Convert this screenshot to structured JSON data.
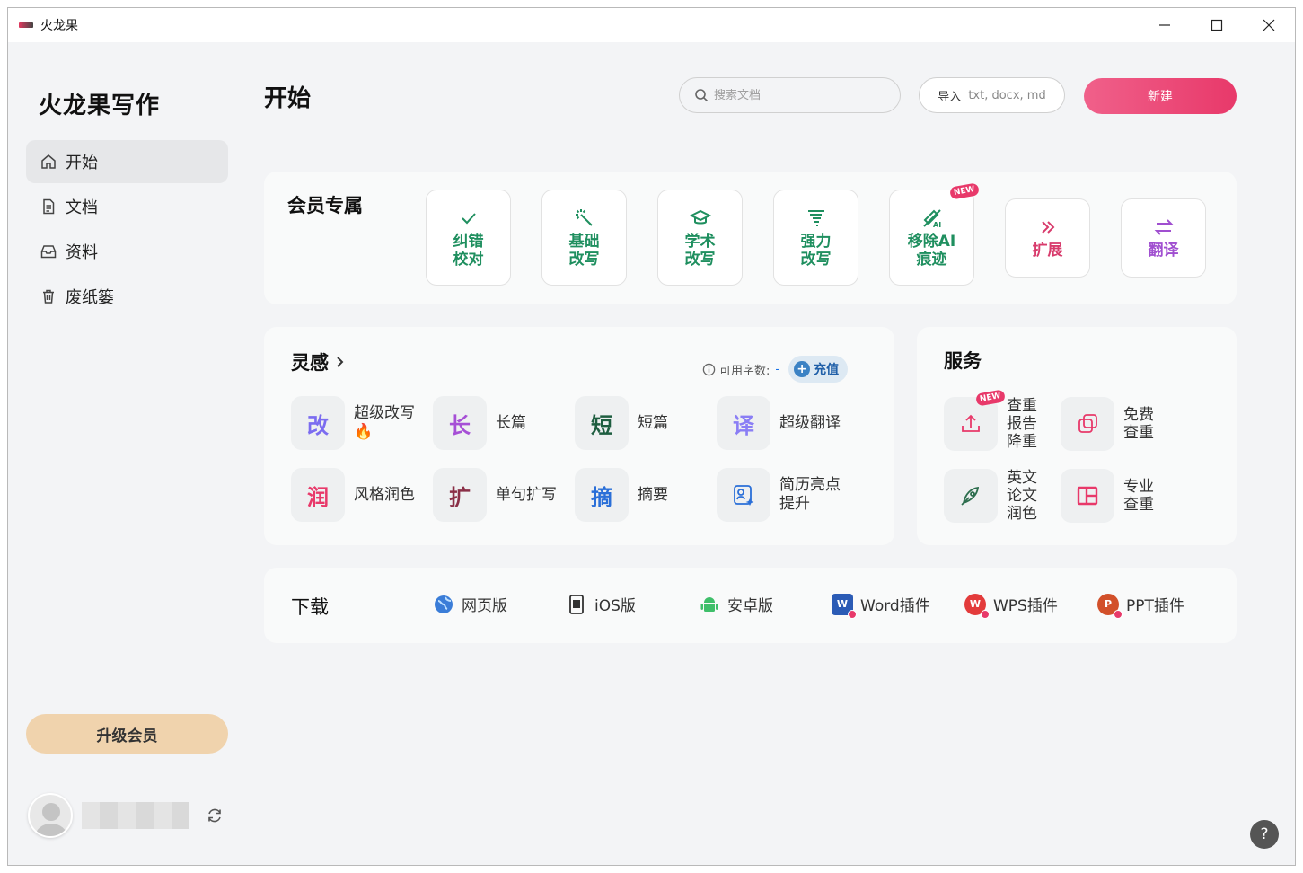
{
  "window": {
    "title": "火龙果"
  },
  "sidebar": {
    "logo_main": "火龙果写作",
    "items": [
      {
        "label": "开始",
        "icon": "home-icon"
      },
      {
        "label": "文档",
        "icon": "document-icon"
      },
      {
        "label": "资料",
        "icon": "inbox-icon"
      },
      {
        "label": "废纸篓",
        "icon": "trash-icon"
      }
    ],
    "upgrade_label": "升级会员"
  },
  "header": {
    "page_title": "开始",
    "search_placeholder": "搜索文档",
    "import_label": "导入",
    "import_formats": "txt, docx, md",
    "new_label": "新建"
  },
  "vip": {
    "title": "会员专属",
    "tiles": [
      {
        "label": "纠错校对",
        "icon": "check-icon",
        "color": "#1f8f5f"
      },
      {
        "label": "基础改写",
        "icon": "magic-wand-icon",
        "color": "#1f8f5f"
      },
      {
        "label": "学术改写",
        "icon": "graduation-cap-icon",
        "color": "#1f8f5f"
      },
      {
        "label": "强力改写",
        "icon": "tornado-icon",
        "color": "#1f8f5f"
      },
      {
        "label": "移除AI痕迹",
        "icon": "remove-ai-icon",
        "color": "#1f8f5f",
        "badge": "NEW"
      },
      {
        "label": "扩展",
        "icon": "double-chevron-icon",
        "color": "#d83b6c"
      },
      {
        "label": "翻译",
        "icon": "swap-arrows-icon",
        "color": "#a04fd0"
      }
    ]
  },
  "inspiration": {
    "title": "灵感",
    "quota_label": "可用字数:",
    "quota_value": "-",
    "recharge_label": "充值",
    "items": [
      {
        "chip": "改",
        "label": "超级改写🔥",
        "color": "#7b6cf0"
      },
      {
        "chip": "长",
        "label": "长篇",
        "color": "#a64fd6"
      },
      {
        "chip": "短",
        "label": "短篇",
        "color": "#1e5e40"
      },
      {
        "chip": "译",
        "label": "超级翻译",
        "color": "#8a7ef5"
      },
      {
        "chip": "润",
        "label": "风格润色",
        "color": "#e8396a"
      },
      {
        "chip": "扩",
        "label": "单句扩写",
        "color": "#8a2f47"
      },
      {
        "chip": "摘",
        "label": "摘要",
        "color": "#2a6fd8"
      },
      {
        "chip": "",
        "label": "简历亮点提升",
        "color": "#2a6fd8",
        "icon": "resume-sparkle-icon"
      }
    ]
  },
  "services": {
    "title": "服务",
    "items": [
      {
        "label": "查重报告降重",
        "icon": "upload-icon",
        "badge": "NEW"
      },
      {
        "label": "免费查重",
        "icon": "copy-squares-icon"
      },
      {
        "label": "英文论文润色",
        "icon": "quill-icon"
      },
      {
        "label": "专业查重",
        "icon": "layout-panel-icon"
      }
    ]
  },
  "download": {
    "title": "下载",
    "items": [
      {
        "label": "网页版",
        "icon": "globe-icon"
      },
      {
        "label": "iOS版",
        "icon": "phone-icon"
      },
      {
        "label": "安卓版",
        "icon": "android-icon"
      },
      {
        "label": "Word插件",
        "icon": "word-icon"
      },
      {
        "label": "WPS插件",
        "icon": "wps-icon"
      },
      {
        "label": "PPT插件",
        "icon": "ppt-icon"
      }
    ]
  },
  "help_label": "?"
}
